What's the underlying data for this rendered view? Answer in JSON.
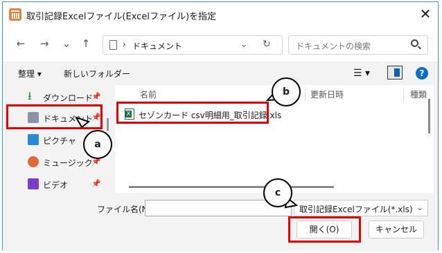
{
  "window": {
    "title": "取引記録Excelファイル(Excelファイル)を指定",
    "close": "✕"
  },
  "nav": {
    "back": "←",
    "forward": "→",
    "recent": "⌄",
    "up": "↑",
    "path_sep": "›",
    "path": "ドキュメント",
    "path_dropdown": "⌄",
    "refresh": "↻"
  },
  "search": {
    "placeholder": "ドキュメントの検索"
  },
  "commands": {
    "organize": "整理 ▾",
    "new_folder": "新しいフォルダー",
    "view": "☰ ▾",
    "help": "?"
  },
  "sidebar": {
    "items": [
      {
        "label": "ダウンロード",
        "icon": "download-icon",
        "pin": "📌"
      },
      {
        "label": "ドキュメント",
        "icon": "document-icon",
        "pin": "📌"
      },
      {
        "label": "ピクチャ",
        "icon": "picture-icon",
        "pin": "📌"
      },
      {
        "label": "ミュージック",
        "icon": "music-icon",
        "pin": "📌"
      },
      {
        "label": "ビデオ",
        "icon": "video-icon",
        "pin": "📌"
      }
    ]
  },
  "columns": {
    "name": "名前",
    "modified": "更新日時",
    "type": "種類"
  },
  "files": [
    {
      "name": "セゾンカード csv明細用_取引記録.xls",
      "icon": "excel-file-icon"
    }
  ],
  "footer": {
    "filename_label": "ファイル名(N):",
    "filename_value": "",
    "filter": "取引記録Excelファイル(*.xls)",
    "filter_dropdown": "⌄",
    "open": "開く(O)",
    "cancel": "キャンセル"
  },
  "annotations": {
    "a": "a",
    "b": "b",
    "c": "c"
  },
  "colors": {
    "highlight": "#e00000",
    "accent": "#0063b1",
    "excel": "#1e7145"
  }
}
